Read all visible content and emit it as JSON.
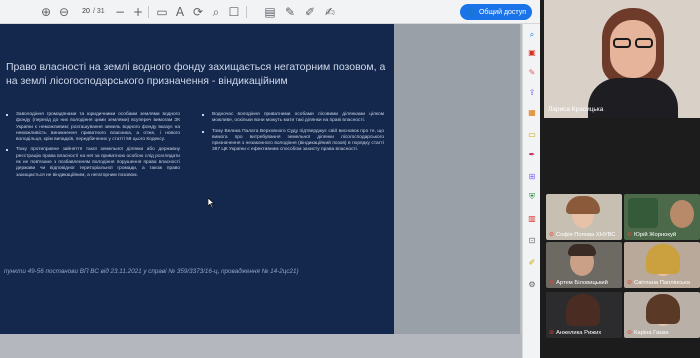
{
  "toolbar": {
    "page_current": "20",
    "page_total": "/ 31",
    "share_label": "Общий доступ"
  },
  "slide": {
    "title": "Право власності на землі водного фонду захищається негаторним позовом, а на землі лісогосподарського призначення - віндикаційним",
    "left_bullets": [
      "Заволодіння громадянами та юридичними особами землями водного фонду (перехід до них володіння цими землями) всупереч вимогам ЗК України є неможливим; розташування земель водного фонду вказує на неможливість виникнення приватного власника, а отже, і нового володільця, крім випадків, передбачених у статті 59 цього Кодексу.",
      "Тому протиправне зайняття такої земельної ділянки або державну реєстрацію права власності на неї за приватною особою слід розглядати як не пов'язане з позбавленням володіння порушення права власності держави чи відповідної територіальної громади, а також право захищається не віндикаційним, а негаторним позовом."
    ],
    "right_bullets": [
      "Водночас володіння приватними особами лісовими ділянками цілком можливе, оскільки вони можуть мати такі ділянки на праві власності.",
      "Тому Велика Палата Верховного Суду підтверджує свій висновок про те, що вимога про витребування земельної ділянки лісогосподарського призначення з незаконного володіння (віндикаційний позов) в порядку статті 387 ЦК України є ефективним способом захисту права власності."
    ],
    "footer": "пункти 49-56 постанови ВП ВС від 23.11.2021 у справі № 359/3373/16-ц, провадження № 14-2цс21)"
  },
  "participants": {
    "main": "Лариса Красицька",
    "tiles": [
      "Софія Попова ХНУВС",
      "Юрій Жорнокуй",
      "Артем Біловицький",
      "Світлана Паплінська",
      "Анжелика Рижих",
      "Каріна Гаєва"
    ]
  },
  "colors": {
    "slide_bg": "#14284e",
    "share_button": "#1a73e8",
    "mic_off": "#ea4335"
  }
}
